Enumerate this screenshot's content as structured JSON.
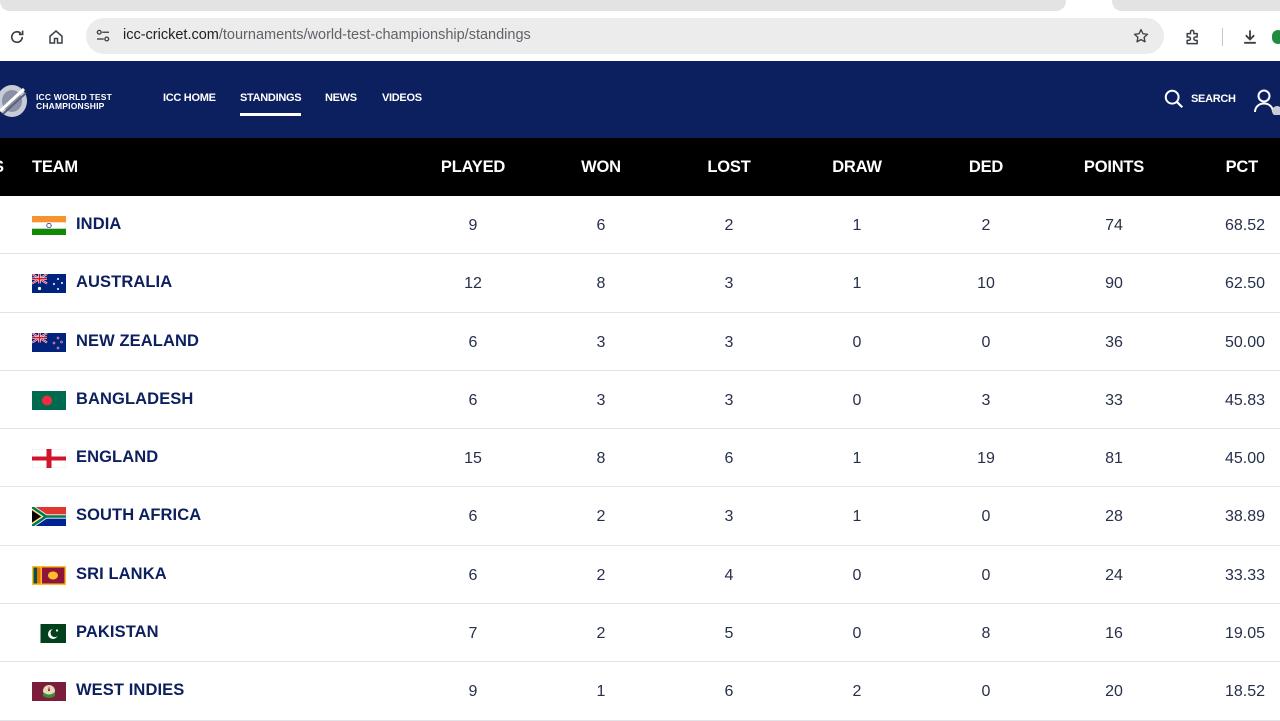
{
  "browser": {
    "url_host": "icc-cricket.com",
    "url_path": "/tournaments/world-test-championship/standings"
  },
  "header": {
    "logo_line1": "ICC WORLD TEST",
    "logo_line2": "CHAMPIONSHIP",
    "nav": [
      {
        "label": "ICC HOME",
        "active": false
      },
      {
        "label": "STANDINGS",
        "active": true
      },
      {
        "label": "NEWS",
        "active": false
      },
      {
        "label": "VIDEOS",
        "active": false
      }
    ],
    "search_label": "SEARCH"
  },
  "table": {
    "pos_header": "S",
    "columns": [
      "TEAM",
      "PLAYED",
      "WON",
      "LOST",
      "DRAW",
      "DED",
      "POINTS",
      "PCT"
    ],
    "rows": [
      {
        "team": "INDIA",
        "flag": "india-flag",
        "played": "9",
        "won": "6",
        "lost": "2",
        "draw": "1",
        "ded": "2",
        "points": "74",
        "pct": "68.52"
      },
      {
        "team": "AUSTRALIA",
        "flag": "australia-flag",
        "played": "12",
        "won": "8",
        "lost": "3",
        "draw": "1",
        "ded": "10",
        "points": "90",
        "pct": "62.50"
      },
      {
        "team": "NEW ZEALAND",
        "flag": "new-zealand-flag",
        "played": "6",
        "won": "3",
        "lost": "3",
        "draw": "0",
        "ded": "0",
        "points": "36",
        "pct": "50.00"
      },
      {
        "team": "BANGLADESH",
        "flag": "bangladesh-flag",
        "played": "6",
        "won": "3",
        "lost": "3",
        "draw": "0",
        "ded": "3",
        "points": "33",
        "pct": "45.83"
      },
      {
        "team": "ENGLAND",
        "flag": "england-flag",
        "played": "15",
        "won": "8",
        "lost": "6",
        "draw": "1",
        "ded": "19",
        "points": "81",
        "pct": "45.00"
      },
      {
        "team": "SOUTH AFRICA",
        "flag": "south-africa-flag",
        "played": "6",
        "won": "2",
        "lost": "3",
        "draw": "1",
        "ded": "0",
        "points": "28",
        "pct": "38.89"
      },
      {
        "team": "SRI LANKA",
        "flag": "sri-lanka-flag",
        "played": "6",
        "won": "2",
        "lost": "4",
        "draw": "0",
        "ded": "0",
        "points": "24",
        "pct": "33.33"
      },
      {
        "team": "PAKISTAN",
        "flag": "pakistan-flag",
        "played": "7",
        "won": "2",
        "lost": "5",
        "draw": "0",
        "ded": "8",
        "points": "16",
        "pct": "19.05"
      },
      {
        "team": "WEST INDIES",
        "flag": "west-indies-flag",
        "played": "9",
        "won": "1",
        "lost": "6",
        "draw": "2",
        "ded": "0",
        "points": "20",
        "pct": "18.52"
      }
    ]
  },
  "colors": {
    "header_bg": "#0c1f5e",
    "table_head_bg": "#000000",
    "team_text": "#0c1f5e"
  }
}
